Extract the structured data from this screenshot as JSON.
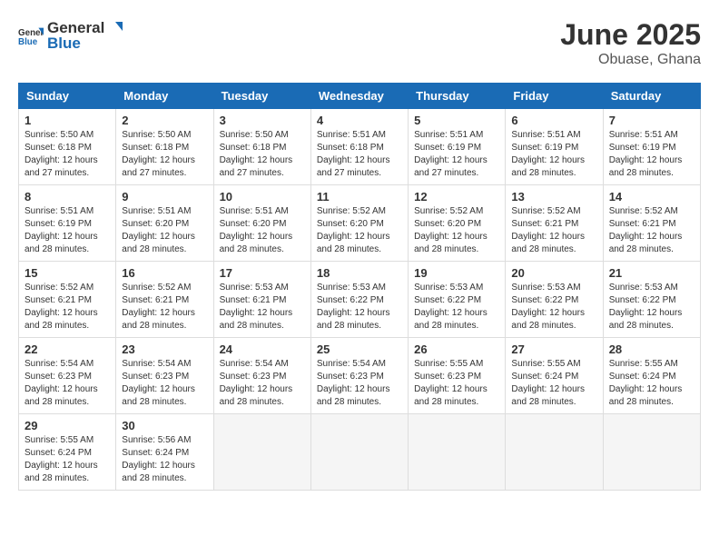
{
  "logo": {
    "text_general": "General",
    "text_blue": "Blue"
  },
  "title": {
    "month_year": "June 2025",
    "location": "Obuase, Ghana"
  },
  "days_of_week": [
    "Sunday",
    "Monday",
    "Tuesday",
    "Wednesday",
    "Thursday",
    "Friday",
    "Saturday"
  ],
  "weeks": [
    [
      {
        "day": "1",
        "sunrise": "5:50 AM",
        "sunset": "6:18 PM",
        "daylight": "12 hours and 27 minutes."
      },
      {
        "day": "2",
        "sunrise": "5:50 AM",
        "sunset": "6:18 PM",
        "daylight": "12 hours and 27 minutes."
      },
      {
        "day": "3",
        "sunrise": "5:50 AM",
        "sunset": "6:18 PM",
        "daylight": "12 hours and 27 minutes."
      },
      {
        "day": "4",
        "sunrise": "5:51 AM",
        "sunset": "6:18 PM",
        "daylight": "12 hours and 27 minutes."
      },
      {
        "day": "5",
        "sunrise": "5:51 AM",
        "sunset": "6:19 PM",
        "daylight": "12 hours and 27 minutes."
      },
      {
        "day": "6",
        "sunrise": "5:51 AM",
        "sunset": "6:19 PM",
        "daylight": "12 hours and 28 minutes."
      },
      {
        "day": "7",
        "sunrise": "5:51 AM",
        "sunset": "6:19 PM",
        "daylight": "12 hours and 28 minutes."
      }
    ],
    [
      {
        "day": "8",
        "sunrise": "5:51 AM",
        "sunset": "6:19 PM",
        "daylight": "12 hours and 28 minutes."
      },
      {
        "day": "9",
        "sunrise": "5:51 AM",
        "sunset": "6:20 PM",
        "daylight": "12 hours and 28 minutes."
      },
      {
        "day": "10",
        "sunrise": "5:51 AM",
        "sunset": "6:20 PM",
        "daylight": "12 hours and 28 minutes."
      },
      {
        "day": "11",
        "sunrise": "5:52 AM",
        "sunset": "6:20 PM",
        "daylight": "12 hours and 28 minutes."
      },
      {
        "day": "12",
        "sunrise": "5:52 AM",
        "sunset": "6:20 PM",
        "daylight": "12 hours and 28 minutes."
      },
      {
        "day": "13",
        "sunrise": "5:52 AM",
        "sunset": "6:21 PM",
        "daylight": "12 hours and 28 minutes."
      },
      {
        "day": "14",
        "sunrise": "5:52 AM",
        "sunset": "6:21 PM",
        "daylight": "12 hours and 28 minutes."
      }
    ],
    [
      {
        "day": "15",
        "sunrise": "5:52 AM",
        "sunset": "6:21 PM",
        "daylight": "12 hours and 28 minutes."
      },
      {
        "day": "16",
        "sunrise": "5:52 AM",
        "sunset": "6:21 PM",
        "daylight": "12 hours and 28 minutes."
      },
      {
        "day": "17",
        "sunrise": "5:53 AM",
        "sunset": "6:21 PM",
        "daylight": "12 hours and 28 minutes."
      },
      {
        "day": "18",
        "sunrise": "5:53 AM",
        "sunset": "6:22 PM",
        "daylight": "12 hours and 28 minutes."
      },
      {
        "day": "19",
        "sunrise": "5:53 AM",
        "sunset": "6:22 PM",
        "daylight": "12 hours and 28 minutes."
      },
      {
        "day": "20",
        "sunrise": "5:53 AM",
        "sunset": "6:22 PM",
        "daylight": "12 hours and 28 minutes."
      },
      {
        "day": "21",
        "sunrise": "5:53 AM",
        "sunset": "6:22 PM",
        "daylight": "12 hours and 28 minutes."
      }
    ],
    [
      {
        "day": "22",
        "sunrise": "5:54 AM",
        "sunset": "6:23 PM",
        "daylight": "12 hours and 28 minutes."
      },
      {
        "day": "23",
        "sunrise": "5:54 AM",
        "sunset": "6:23 PM",
        "daylight": "12 hours and 28 minutes."
      },
      {
        "day": "24",
        "sunrise": "5:54 AM",
        "sunset": "6:23 PM",
        "daylight": "12 hours and 28 minutes."
      },
      {
        "day": "25",
        "sunrise": "5:54 AM",
        "sunset": "6:23 PM",
        "daylight": "12 hours and 28 minutes."
      },
      {
        "day": "26",
        "sunrise": "5:55 AM",
        "sunset": "6:23 PM",
        "daylight": "12 hours and 28 minutes."
      },
      {
        "day": "27",
        "sunrise": "5:55 AM",
        "sunset": "6:24 PM",
        "daylight": "12 hours and 28 minutes."
      },
      {
        "day": "28",
        "sunrise": "5:55 AM",
        "sunset": "6:24 PM",
        "daylight": "12 hours and 28 minutes."
      }
    ],
    [
      {
        "day": "29",
        "sunrise": "5:55 AM",
        "sunset": "6:24 PM",
        "daylight": "12 hours and 28 minutes."
      },
      {
        "day": "30",
        "sunrise": "5:56 AM",
        "sunset": "6:24 PM",
        "daylight": "12 hours and 28 minutes."
      },
      null,
      null,
      null,
      null,
      null
    ]
  ],
  "labels": {
    "sunrise_prefix": "Sunrise: ",
    "sunset_prefix": "Sunset: ",
    "daylight_prefix": "Daylight: "
  }
}
